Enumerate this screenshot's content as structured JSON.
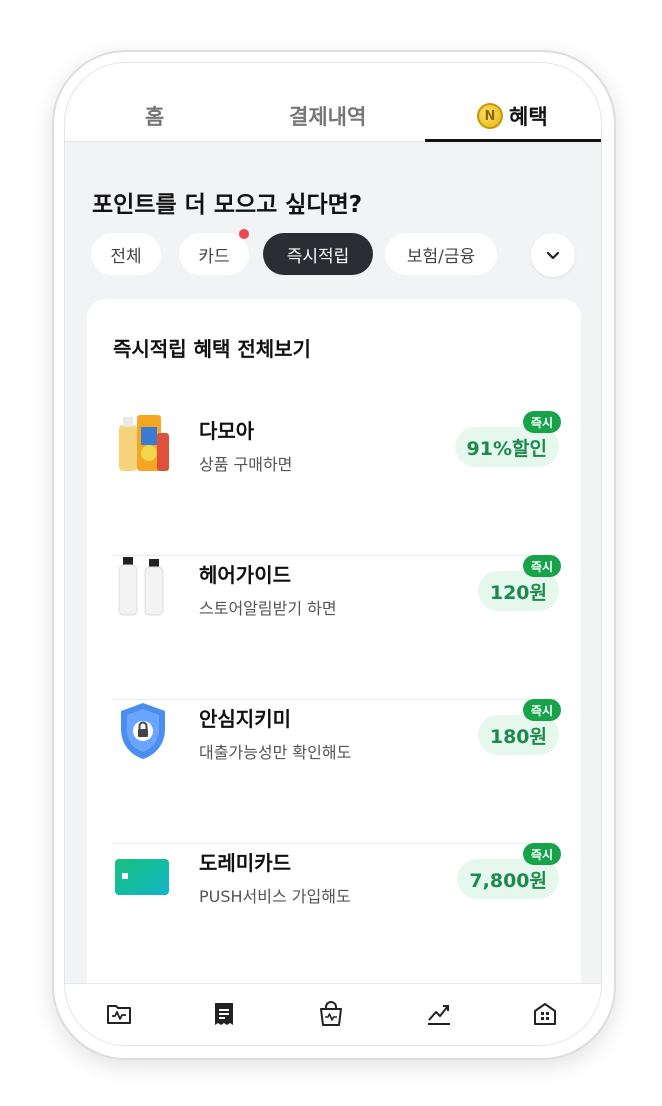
{
  "tabs": {
    "home": "홈",
    "payments": "결제내역",
    "benefits": "혜택",
    "coin_letter": "N"
  },
  "headline": "포인트를 더 모으고 싶다면?",
  "chips": {
    "all": "전체",
    "card": "카드",
    "instant": "즉시적립",
    "insurance": "보험/금융"
  },
  "panel": {
    "title": "즉시적립 혜택 전체보기",
    "items": [
      {
        "name": "다모아",
        "desc": "상품 구매하면",
        "reward": "91%할인",
        "badge": "즉시"
      },
      {
        "name": "헤어가이드",
        "desc": "스토어알림받기 하면",
        "reward": "120원",
        "badge": "즉시"
      },
      {
        "name": "안심지키미",
        "desc": "대출가능성만 확인해도",
        "reward": "180원",
        "badge": "즉시"
      },
      {
        "name": "도레미카드",
        "desc": "PUSH서비스 가입해도",
        "reward": "7,800원",
        "badge": "즉시"
      }
    ]
  },
  "colors": {
    "accent_green": "#16a34a",
    "pill_bg": "#e6f7ee",
    "dark_chip": "#2b2d32",
    "red_dot": "#f0464e"
  },
  "bottom_nav": {
    "icons": [
      "folder-chart-icon",
      "receipt-icon",
      "shopping-bag-icon",
      "trend-chart-icon",
      "building-icon"
    ]
  }
}
